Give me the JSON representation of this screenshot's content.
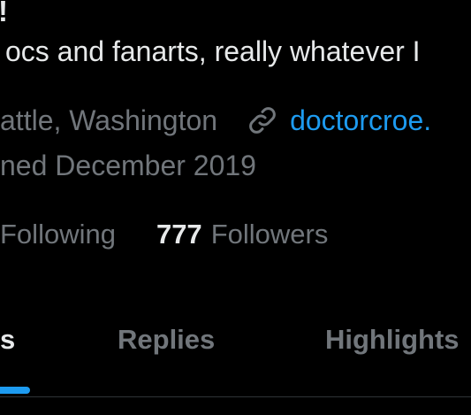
{
  "profile": {
    "name_fragment": "!",
    "bio_fragment": "ocs and fanarts, really whatever I",
    "location_fragment": "attle, Washington",
    "website_fragment": "doctorcroe.",
    "joined_fragment": "ned December 2019",
    "following_label_fragment": "Following",
    "followers_count": "777",
    "followers_label": "Followers"
  },
  "icons": {
    "link": "link-icon"
  },
  "tabs": [
    {
      "label": "s",
      "active": true
    },
    {
      "label": "Replies",
      "active": false
    },
    {
      "label": "Highlights",
      "active": false
    }
  ],
  "colors": {
    "background": "#000000",
    "primary_text": "#e7e9ea",
    "secondary_text": "#71767b",
    "accent": "#1d9bf0",
    "divider": "#2f3336"
  }
}
